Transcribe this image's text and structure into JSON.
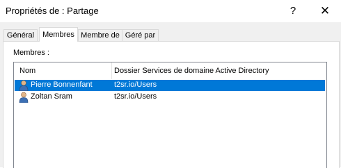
{
  "window": {
    "title": "Propriétés de : Partage",
    "help_label": "?",
    "close_label": "✕"
  },
  "tabs": [
    {
      "label": "Général",
      "active": false
    },
    {
      "label": "Membres",
      "active": true
    },
    {
      "label": "Membre de",
      "active": false
    },
    {
      "label": "Géré par",
      "active": false
    }
  ],
  "members": {
    "label": "Membres :",
    "columns": [
      "Nom",
      "Dossier Services de domaine Active Directory"
    ],
    "rows": [
      {
        "name": "Pierre Bonnenfant",
        "folder": "t2sr.io/Users",
        "selected": true,
        "icon": "user-icon"
      },
      {
        "name": "Zoltan Sram",
        "folder": "t2sr.io/Users",
        "selected": false,
        "icon": "user-icon"
      }
    ]
  },
  "colors": {
    "selection": "#0078d7",
    "dialog_background": "#f0f0f0"
  }
}
